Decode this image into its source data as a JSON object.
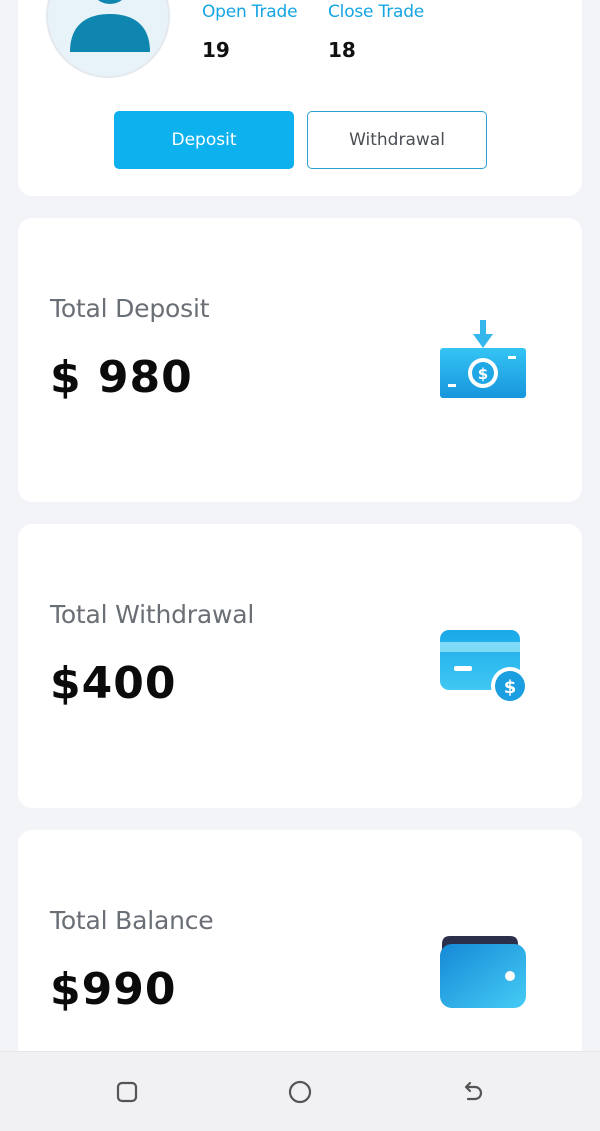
{
  "profile": {
    "stats": [
      {
        "label": "Open Trade",
        "value": "19"
      },
      {
        "label": "Close Trade",
        "value": "18"
      }
    ],
    "deposit_button": "Deposit",
    "withdrawal_button": "Withdrawal"
  },
  "summary": [
    {
      "label": "Total Deposit",
      "amount": "$ 980",
      "icon": "cash-deposit-icon"
    },
    {
      "label": "Total Withdrawal",
      "amount": "$400",
      "icon": "card-withdraw-icon"
    },
    {
      "label": "Total Balance",
      "amount": "$990",
      "icon": "wallet-icon"
    }
  ],
  "colors": {
    "accent": "#0db1ee",
    "stat_label": "#14a5e3",
    "icon_blue": "#1fa7e6",
    "wallet_dark": "#2b2f4a"
  },
  "navbar": {
    "icons": [
      "recent-apps-icon",
      "home-icon",
      "back-icon"
    ]
  }
}
